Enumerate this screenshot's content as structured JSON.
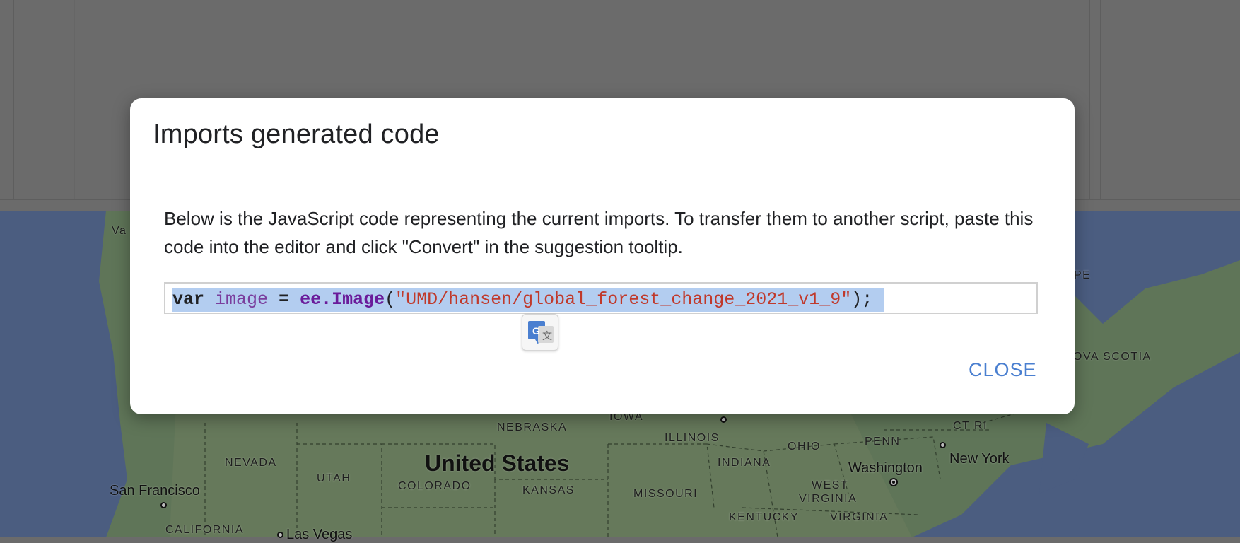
{
  "dialog": {
    "title": "Imports generated code",
    "description": "Below is the JavaScript code representing the current imports. To transfer them to another script, paste this code into the editor and click \"Convert\" in the suggestion tooltip.",
    "code": {
      "keyword": "var",
      "variable": "image",
      "operator": "=",
      "function": "ee.Image",
      "open_paren": "(",
      "string": "\"UMD/hansen/global_forest_change_2021_v1_9\"",
      "close": ");"
    },
    "close_label": "CLOSE"
  },
  "map": {
    "country_label": "United States",
    "state_labels": {
      "nebraska": "NEBRASKA",
      "iowa": "IOWA",
      "illinois": "ILLINOIS",
      "nevada": "NEVADA",
      "utah": "UTAH",
      "colorado": "COLORADO",
      "kansas": "KANSAS",
      "missouri": "MISSOURI",
      "indiana": "INDIANA",
      "ohio": "OHIO",
      "penn": "PENN",
      "west_virginia_1": "WEST",
      "west_virginia_2": "VIRGINIA",
      "kentucky": "KENTUCKY",
      "virginia": "VIRGINIA",
      "ct_ri": "CT RI",
      "pe": "PE",
      "nova_scotia": "OVA SCOTIA",
      "california": "CALIFORNIA",
      "va_partial": "Va"
    },
    "city_labels": {
      "san_francisco": "San Francisco",
      "washington": "Washington",
      "new_york": "New York",
      "las_vegas": "Las Vegas"
    }
  },
  "colors": {
    "link_blue": "#4a7fd0",
    "code_highlight": "#b3cdf0",
    "string_red": "#c0392b",
    "identifier_purple": "#7a3e9d"
  }
}
